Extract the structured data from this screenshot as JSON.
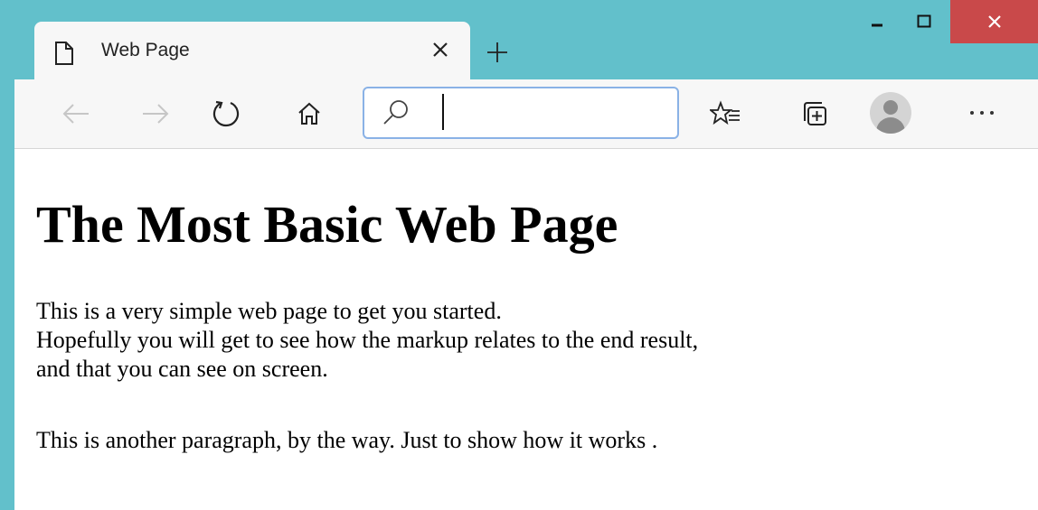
{
  "browser": {
    "tab": {
      "title": "Web Page",
      "close_label": "×",
      "icon": "document-icon"
    },
    "new_tab_label": "+",
    "window_controls": {
      "minimize": "minimize-icon",
      "maximize": "maximize-icon",
      "close": "close-icon"
    },
    "colors": {
      "frame": "#62c0cb",
      "close_button": "#c9494a",
      "toolbar": "#f7f7f7",
      "address_border": "#8ab2e6"
    },
    "toolbar": {
      "back_icon": "arrow-left-icon",
      "forward_icon": "arrow-right-icon",
      "refresh_icon": "refresh-icon",
      "home_icon": "home-icon",
      "favorites_icon": "favorites-icon",
      "collections_icon": "collections-icon",
      "profile_icon": "avatar-icon",
      "more_icon": "more-icon"
    },
    "address_bar": {
      "value": "",
      "placeholder": ""
    }
  },
  "page": {
    "heading": "The Most Basic Web Page",
    "paragraph1": [
      "This is a very simple web page to get you started.",
      "Hopefully you will get to see how the markup relates to the end result,",
      "and that you can see on screen."
    ],
    "paragraph2": "This is another paragraph, by the way. Just to show how it works ."
  }
}
